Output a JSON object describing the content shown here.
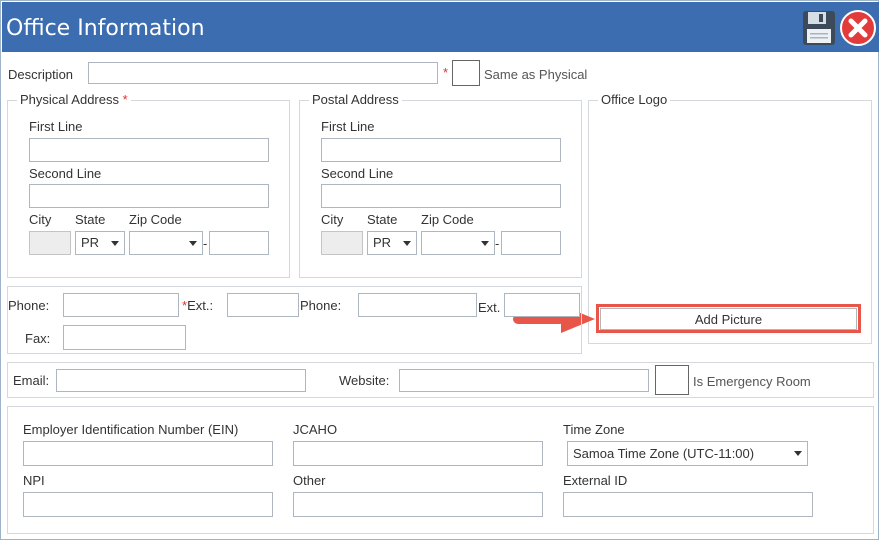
{
  "window": {
    "title": "Office Information",
    "accent": "#3b6db0"
  },
  "description": {
    "label": "Description",
    "required_mark": "*",
    "same_as_physical_label": "Same as Physical"
  },
  "physical_address": {
    "legend": "Physical Address",
    "required_mark": "*",
    "first_line_label": "First Line",
    "second_line_label": "Second Line",
    "city_label": "City",
    "state_label": "State",
    "zip_label": "Zip Code",
    "state_value": "PR",
    "zip_separator": "-"
  },
  "postal_address": {
    "legend": "Postal Address",
    "first_line_label": "First Line",
    "second_line_label": "Second Line",
    "city_label": "City",
    "state_label": "State",
    "zip_label": "Zip Code",
    "state_value": "PR",
    "zip_separator": "-"
  },
  "office_logo": {
    "legend": "Office Logo",
    "add_picture_label": "Add Picture"
  },
  "phones": {
    "phone1_label": "Phone:",
    "required_mark": "*",
    "ext1_label": "Ext.:",
    "phone2_label": "Phone:",
    "ext2_label": "Ext.",
    "fax_label": "Fax:"
  },
  "contact": {
    "email_label": "Email:",
    "website_label": "Website:",
    "emergency_label": "Is Emergency Room"
  },
  "identifiers": {
    "ein_label": "Employer Identification Number (EIN)",
    "jcaho_label": "JCAHO",
    "timezone_label": "Time Zone",
    "timezone_value": "Samoa Time Zone (UTC-11:00)",
    "npi_label": "NPI",
    "other_label": "Other",
    "external_id_label": "External ID"
  },
  "annotation": {
    "color": "#e8564a"
  }
}
